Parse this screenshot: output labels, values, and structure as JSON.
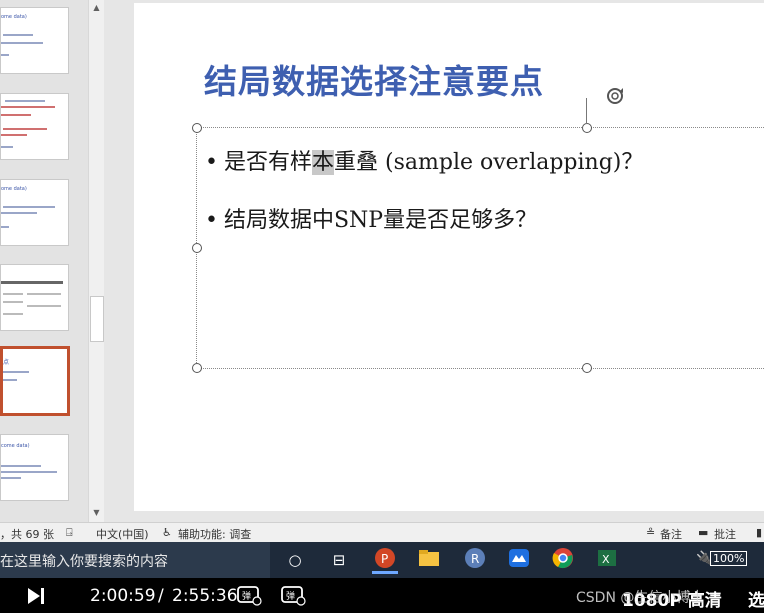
{
  "slide": {
    "title": "结局数据选择注意要点",
    "bullets": [
      {
        "pre": "是否有样",
        "highlight": "本",
        "post": "重叠 (sample overlapping)？"
      },
      {
        "pre": "结局数据中SNP量是否足够多？",
        "highlight": "",
        "post": ""
      }
    ]
  },
  "thumbnails": {
    "t1_title": "ome data)",
    "t3_title": "ome data)",
    "t5_title": "点",
    "t6_title": "come data)"
  },
  "status": {
    "slide_count": "，共 69 张",
    "language": "中文(中国)",
    "accessibility": "辅助功能: 调查",
    "notes": "备注",
    "comments": "批注"
  },
  "taskbar": {
    "search_placeholder": "在这里输入你要搜索的内容",
    "battery": "100%"
  },
  "player": {
    "current_time": "2:00:59",
    "separator": "/",
    "total_time": "2:55:36",
    "quality": "1080P 高清",
    "watermark": "CSDN @生信小博士",
    "more": "选"
  },
  "colors": {
    "title_blue": "#3e5fb0",
    "active_thumb_border": "#c0502e"
  }
}
